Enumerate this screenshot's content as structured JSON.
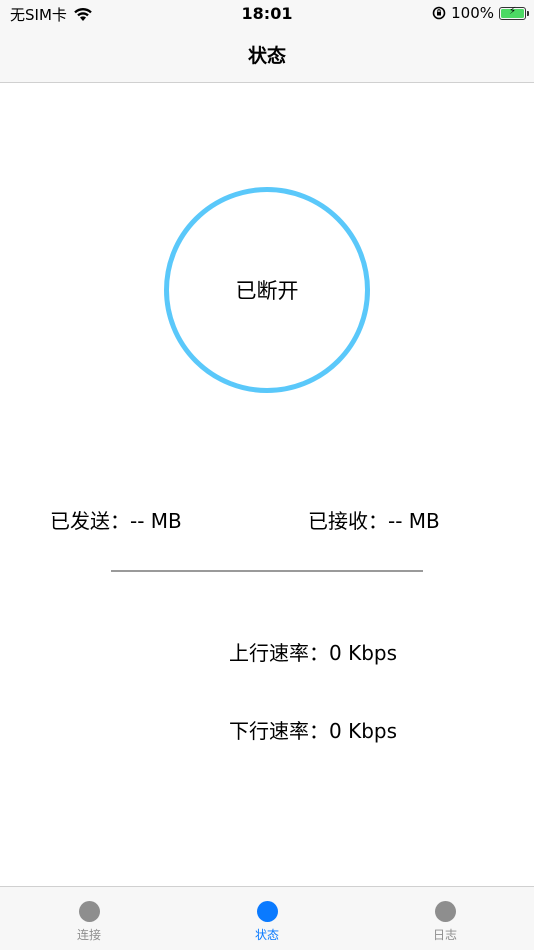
{
  "status_bar": {
    "carrier": "无SIM卡",
    "time": "18:01",
    "battery_percent": "100%",
    "battery_level": 1.0
  },
  "nav": {
    "title": "状态"
  },
  "connection": {
    "state": "已断开",
    "ring_color": "#5ac8fa"
  },
  "stats": {
    "sent": "已发送：-- MB",
    "received": "已接收：-- MB"
  },
  "rates": {
    "upload": "上行速率：0 Kbps",
    "download": "下行速率：0 Kbps"
  },
  "tabs": [
    {
      "label": "连接",
      "active": false
    },
    {
      "label": "状态",
      "active": true
    },
    {
      "label": "日志",
      "active": false
    }
  ],
  "colors": {
    "active_tab": "#0a7aff",
    "inactive_tab": "#8e8e8e",
    "battery": "#4cd964"
  }
}
